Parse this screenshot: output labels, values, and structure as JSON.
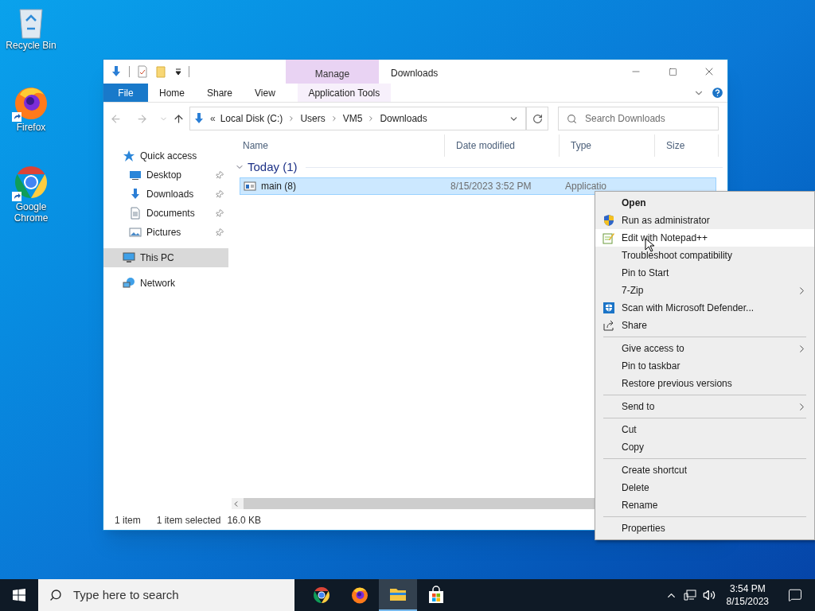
{
  "desktop_icons": [
    {
      "label": "Recycle Bin"
    },
    {
      "label": "Firefox"
    },
    {
      "label": "Google Chrome"
    }
  ],
  "window": {
    "title": "Downloads",
    "contextual_group": "Manage",
    "ribbon_tabs": [
      {
        "label": "File",
        "kind": "file"
      },
      {
        "label": "Home",
        "kind": "tab"
      },
      {
        "label": "Share",
        "kind": "tab"
      },
      {
        "label": "View",
        "kind": "tab"
      },
      {
        "label": "Application Tools",
        "kind": "contextual"
      }
    ],
    "address": {
      "overflow": "«",
      "crumbs": [
        "Local Disk (C:)",
        "Users",
        "VM5",
        "Downloads"
      ]
    },
    "search": {
      "placeholder": "Search Downloads"
    },
    "nav": [
      {
        "label": "Quick access",
        "pinned": false,
        "selected": false
      },
      {
        "label": "Desktop",
        "pinned": true,
        "selected": false
      },
      {
        "label": "Downloads",
        "pinned": true,
        "selected": false
      },
      {
        "label": "Documents",
        "pinned": true,
        "selected": false
      },
      {
        "label": "Pictures",
        "pinned": true,
        "selected": false
      },
      {
        "label": "This PC",
        "pinned": false,
        "selected": true
      },
      {
        "label": "Network",
        "pinned": false,
        "selected": false
      }
    ],
    "columns": [
      "Name",
      "Date modified",
      "Type",
      "Size"
    ],
    "groups": [
      {
        "label": "Today (1)",
        "expanded": true,
        "files": [
          {
            "name": "main (8)",
            "date": "8/15/2023 3:52 PM",
            "type": "Applicatio",
            "selected": true
          }
        ]
      }
    ],
    "status_bar": {
      "count": "1 item",
      "selection": "1 item selected",
      "size": "16.0 KB"
    }
  },
  "context_menu": [
    {
      "kind": "item",
      "label": "Open",
      "bold": true,
      "submenu": false,
      "hovered": false
    },
    {
      "kind": "item",
      "label": "Run as administrator",
      "bold": false,
      "submenu": false,
      "hovered": false
    },
    {
      "kind": "item",
      "label": "Edit with Notepad++",
      "bold": false,
      "submenu": false,
      "hovered": true
    },
    {
      "kind": "item",
      "label": "Troubleshoot compatibility",
      "bold": false,
      "submenu": false,
      "hovered": false
    },
    {
      "kind": "item",
      "label": "Pin to Start",
      "bold": false,
      "submenu": false,
      "hovered": false
    },
    {
      "kind": "item",
      "label": "7-Zip",
      "bold": false,
      "submenu": true,
      "hovered": false
    },
    {
      "kind": "item",
      "label": "Scan with Microsoft Defender...",
      "bold": false,
      "submenu": false,
      "hovered": false
    },
    {
      "kind": "item",
      "label": "Share",
      "bold": false,
      "submenu": false,
      "hovered": false
    },
    {
      "kind": "separator"
    },
    {
      "kind": "item",
      "label": "Give access to",
      "bold": false,
      "submenu": true,
      "hovered": false
    },
    {
      "kind": "item",
      "label": "Pin to taskbar",
      "bold": false,
      "submenu": false,
      "hovered": false
    },
    {
      "kind": "item",
      "label": "Restore previous versions",
      "bold": false,
      "submenu": false,
      "hovered": false
    },
    {
      "kind": "separator"
    },
    {
      "kind": "item",
      "label": "Send to",
      "bold": false,
      "submenu": true,
      "hovered": false
    },
    {
      "kind": "separator"
    },
    {
      "kind": "item",
      "label": "Cut",
      "bold": false,
      "submenu": false,
      "hovered": false
    },
    {
      "kind": "item",
      "label": "Copy",
      "bold": false,
      "submenu": false,
      "hovered": false
    },
    {
      "kind": "separator"
    },
    {
      "kind": "item",
      "label": "Create shortcut",
      "bold": false,
      "submenu": false,
      "hovered": false
    },
    {
      "kind": "item",
      "label": "Delete",
      "bold": false,
      "submenu": false,
      "hovered": false
    },
    {
      "kind": "item",
      "label": "Rename",
      "bold": false,
      "submenu": false,
      "hovered": false
    },
    {
      "kind": "separator"
    },
    {
      "kind": "item",
      "label": "Properties",
      "bold": false,
      "submenu": false,
      "hovered": false
    }
  ],
  "taskbar": {
    "search_placeholder": "Type here to search",
    "apps": [
      {
        "selected": false
      },
      {
        "selected": false
      },
      {
        "selected": true
      },
      {
        "selected": false
      }
    ],
    "time": "3:54 PM",
    "date": "8/15/2023"
  }
}
